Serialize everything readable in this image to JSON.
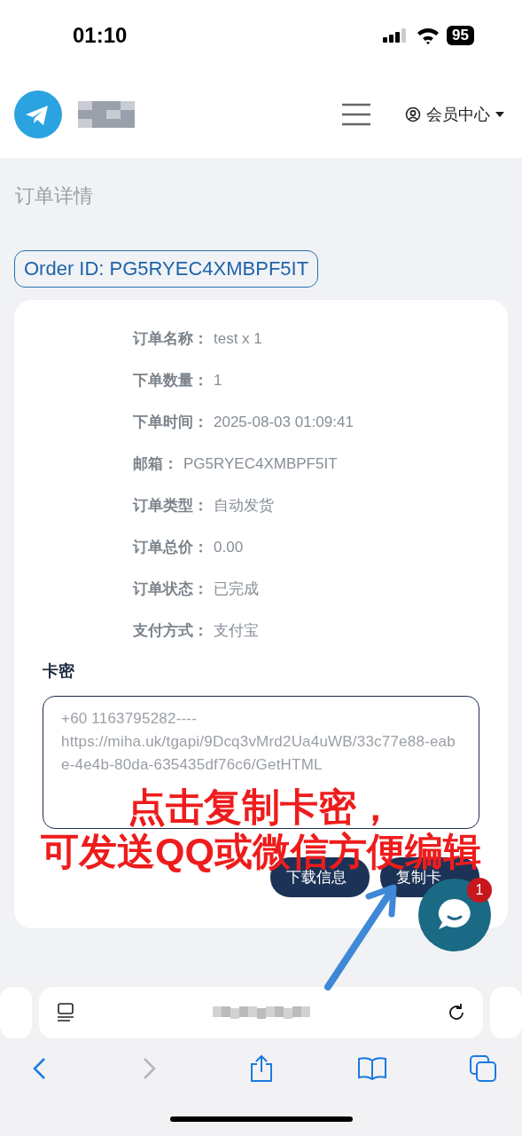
{
  "status_bar": {
    "time": "01:10",
    "battery": "95"
  },
  "header": {
    "member_menu": "会员中心"
  },
  "page_title": "订单详情",
  "order_id_badge": "Order ID: PG5RYEC4XMBPF5IT",
  "details": [
    {
      "label": "订单名称：",
      "value": "test x 1"
    },
    {
      "label": "下单数量：",
      "value": "1"
    },
    {
      "label": "下单时间：",
      "value": "2025-08-03 01:09:41"
    },
    {
      "label": "邮箱：",
      "value": "PG5RYEC4XMBPF5IT"
    },
    {
      "label": "订单类型：",
      "value": "自动发货"
    },
    {
      "label": "订单总价：",
      "value": "0.00"
    },
    {
      "label": "订单状态：",
      "value": "已完成"
    },
    {
      "label": "支付方式：",
      "value": "支付宝"
    }
  ],
  "card_key": {
    "label": "卡密",
    "value": "+60 1163795282----\nhttps://miha.uk/tgapi/9Dcq3vMrd2Ua4uWB/33c77e88-eabe-4e4b-80da-635435df76c6/GetHTML"
  },
  "buttons": [
    "下载信息",
    "复制卡"
  ],
  "chat": {
    "badge": "1"
  },
  "annotation": [
    "点击复制卡密，",
    "可发送QQ或微信方便编辑"
  ],
  "browser": {
    "forward_enabled": false
  }
}
